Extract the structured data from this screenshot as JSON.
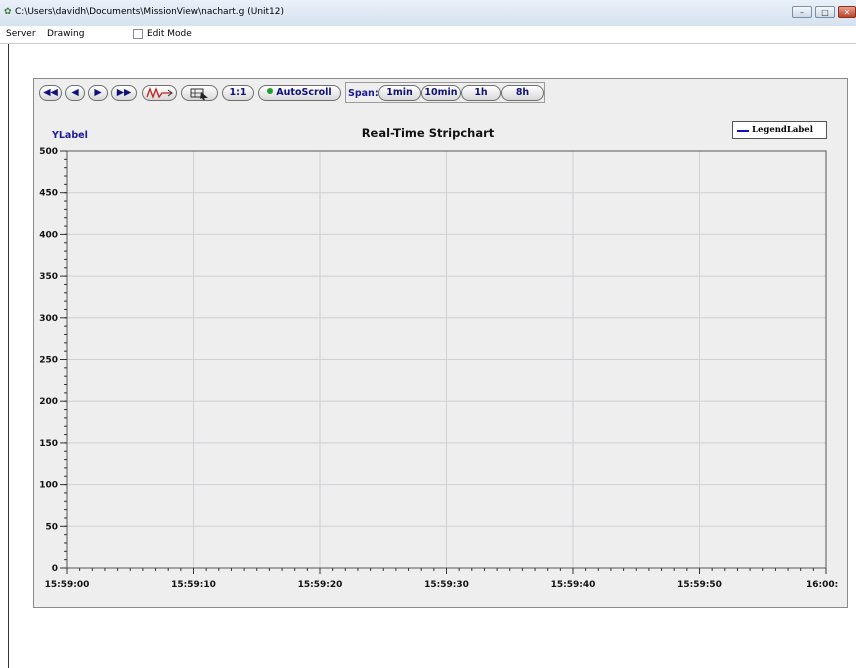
{
  "window": {
    "title": "C:\\Users\\davidh\\Documents\\MissionView\\nachart.g (Unit12)",
    "controls": {
      "minimize": "–",
      "maximize": "□",
      "close": "✕"
    }
  },
  "menu": {
    "items": [
      "Server",
      "Drawing"
    ],
    "edit_mode_label": "Edit Mode",
    "edit_mode_checked": false
  },
  "toolbar": {
    "rewind_icon": "◀◀",
    "back_icon": "◀",
    "play_icon": "▶",
    "forward_icon": "▶▶",
    "one_to_one_label": "1:1",
    "autoscroll_label": "AutoScroll",
    "autoscroll_indicator_color": "#1e9e2e",
    "span_label": "Span:",
    "span_options": [
      "1min",
      "10min",
      "1h",
      "8h"
    ]
  },
  "chart_data": {
    "type": "line",
    "title": "Real-Time Stripchart",
    "ylabel": "YLabel",
    "xlabel": "",
    "ylim": [
      0,
      500
    ],
    "y_ticks": [
      "0",
      "50",
      "100",
      "150",
      "200",
      "250",
      "300",
      "350",
      "400",
      "450",
      "500"
    ],
    "x_ticks": [
      "15:59:00",
      "15:59:10",
      "15:59:20",
      "15:59:30",
      "15:59:40",
      "15:59:50",
      "16:00:"
    ],
    "xlim": [
      "15:59:00",
      "16:00:00"
    ],
    "grid": true,
    "legend_position": "top-right",
    "series": [
      {
        "name": "LegendLabel",
        "color": "#1010c0",
        "values": []
      }
    ]
  }
}
